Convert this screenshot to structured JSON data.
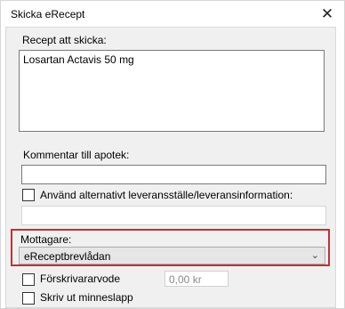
{
  "window": {
    "title": "Skicka eRecept",
    "close_glyph": "✕"
  },
  "recipe": {
    "label": "Recept att skicka:",
    "value": "Losartan Actavis 50 mg"
  },
  "comment": {
    "label": "Kommentar till apotek:",
    "value": ""
  },
  "alt_delivery": {
    "label": "Använd alternativt leveransställe/leveransinformation:",
    "checked": false,
    "value": ""
  },
  "recipient": {
    "label": "Mottagare:",
    "selected": "eReceptbrevlådan",
    "highlight_color": "#c0313a"
  },
  "prescriber_fee": {
    "label": "Förskrivararvode",
    "checked": false,
    "amount": "0,00 kr"
  },
  "print_memo": {
    "label": "Skriv ut minneslapp",
    "checked": false
  }
}
